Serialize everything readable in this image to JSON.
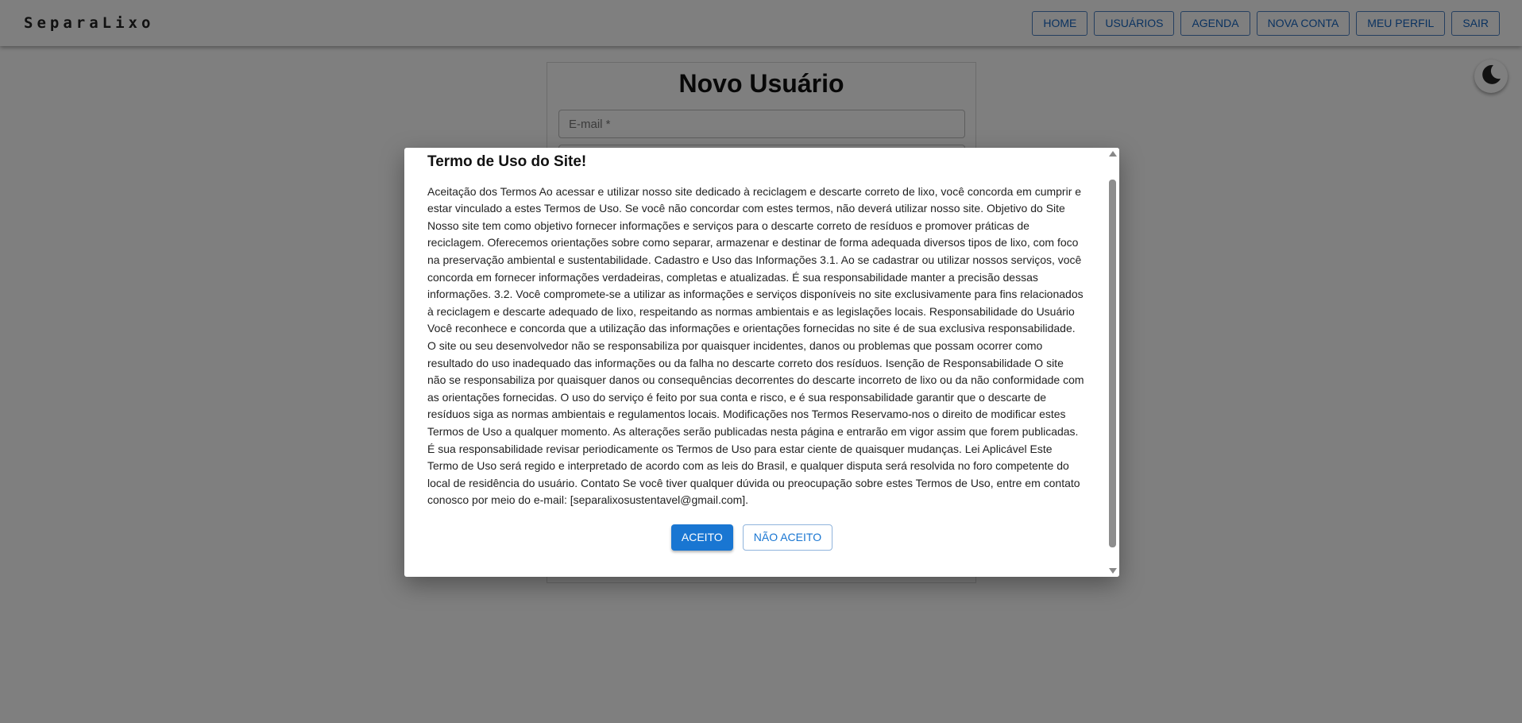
{
  "header": {
    "brand": "SeparaLixo",
    "nav": [
      {
        "label": "HOME"
      },
      {
        "label": "USUÁRIOS"
      },
      {
        "label": "AGENDA"
      },
      {
        "label": "NOVA CONTA"
      },
      {
        "label": "MEU PERFIL"
      },
      {
        "label": "SAIR"
      }
    ]
  },
  "form": {
    "title": "Novo Usuário",
    "email_placeholder": "E-mail *"
  },
  "theme_toggle": {
    "icon": "moon-icon"
  },
  "dialog": {
    "title": "Termo de Uso do Site!",
    "body": "Aceitação dos Termos Ao acessar e utilizar nosso site dedicado à reciclagem e descarte correto de lixo, você concorda em cumprir e estar vinculado a estes Termos de Uso. Se você não concordar com estes termos, não deverá utilizar nosso site. Objetivo do Site Nosso site tem como objetivo fornecer informações e serviços para o descarte correto de resíduos e promover práticas de reciclagem. Oferecemos orientações sobre como separar, armazenar e destinar de forma adequada diversos tipos de lixo, com foco na preservação ambiental e sustentabilidade. Cadastro e Uso das Informações 3.1. Ao se cadastrar ou utilizar nossos serviços, você concorda em fornecer informações verdadeiras, completas e atualizadas. É sua responsabilidade manter a precisão dessas informações. 3.2. Você compromete-se a utilizar as informações e serviços disponíveis no site exclusivamente para fins relacionados à reciclagem e descarte adequado de lixo, respeitando as normas ambientais e as legislações locais. Responsabilidade do Usuário Você reconhece e concorda que a utilização das informações e orientações fornecidas no site é de sua exclusiva responsabilidade. O site ou seu desenvolvedor não se responsabiliza por quaisquer incidentes, danos ou problemas que possam ocorrer como resultado do uso inadequado das informações ou da falha no descarte correto dos resíduos. Isenção de Responsabilidade O site não se responsabiliza por quaisquer danos ou consequências decorrentes do descarte incorreto de lixo ou da não conformidade com as orientações fornecidas. O uso do serviço é feito por sua conta e risco, e é sua responsabilidade garantir que o descarte de resíduos siga as normas ambientais e regulamentos locais. Modificações nos Termos Reservamo-nos o direito de modificar estes Termos de Uso a qualquer momento. As alterações serão publicadas nesta página e entrarão em vigor assim que forem publicadas. É sua responsabilidade revisar periodicamente os Termos de Uso para estar ciente de quaisquer mudanças. Lei Aplicável Este Termo de Uso será regido e interpretado de acordo com as leis do Brasil, e qualquer disputa será resolvida no foro competente do local de residência do usuário. Contato Se você tiver qualquer dúvida ou preocupação sobre estes Termos de Uso, entre em contato conosco por meio do e-mail: [separalixosustentavel@gmail.com].",
    "accept_label": "ACEITO",
    "reject_label": "NÃO ACEITO"
  },
  "colors": {
    "primary": "#1976d2",
    "backdrop": "rgba(0,0,0,0.5)"
  }
}
